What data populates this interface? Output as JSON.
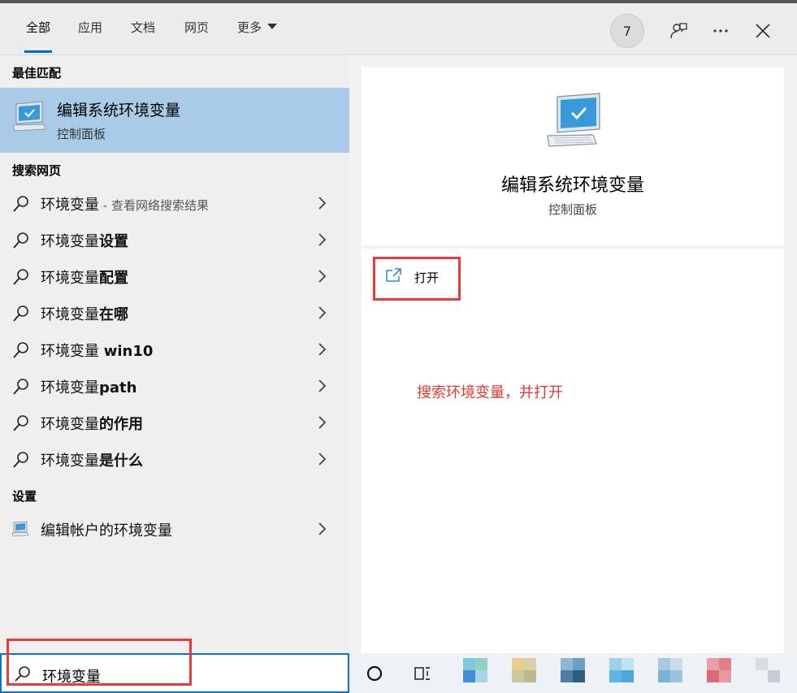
{
  "tabs": [
    {
      "label": "全部"
    },
    {
      "label": "应用"
    },
    {
      "label": "文档"
    },
    {
      "label": "网页"
    },
    {
      "label": "更多"
    }
  ],
  "header": {
    "badge_count": "7"
  },
  "sections": {
    "best_match": "最佳匹配",
    "search_web": "搜索网页",
    "settings": "设置"
  },
  "best_match": {
    "title": "编辑系统环境变量",
    "subtitle": "控制面板"
  },
  "web_results": [
    {
      "prefix": "环境变量",
      "bold": "",
      "sub": " - 查看网络搜索结果"
    },
    {
      "prefix": "环境变量",
      "bold": "设置",
      "sub": ""
    },
    {
      "prefix": "环境变量",
      "bold": "配置",
      "sub": ""
    },
    {
      "prefix": "环境变量",
      "bold": "在哪",
      "sub": ""
    },
    {
      "prefix": "环境变量 ",
      "bold": "win10",
      "sub": ""
    },
    {
      "prefix": "环境变量",
      "bold": "path",
      "sub": ""
    },
    {
      "prefix": "环境变量",
      "bold": "的作用",
      "sub": ""
    },
    {
      "prefix": "环境变量",
      "bold": "是什么",
      "sub": ""
    }
  ],
  "settings_results": [
    {
      "label": "编辑帐户的环境变量"
    }
  ],
  "detail": {
    "title": "编辑系统环境变量",
    "subtitle": "控制面板",
    "open_label": "打开",
    "annotation": "搜索环境变量，并打开"
  },
  "search": {
    "query": "环境变量"
  },
  "colors": {
    "accent": "#0067c0",
    "selected_bg": "#a9cbe8",
    "annotation_red": "#e8393b"
  }
}
